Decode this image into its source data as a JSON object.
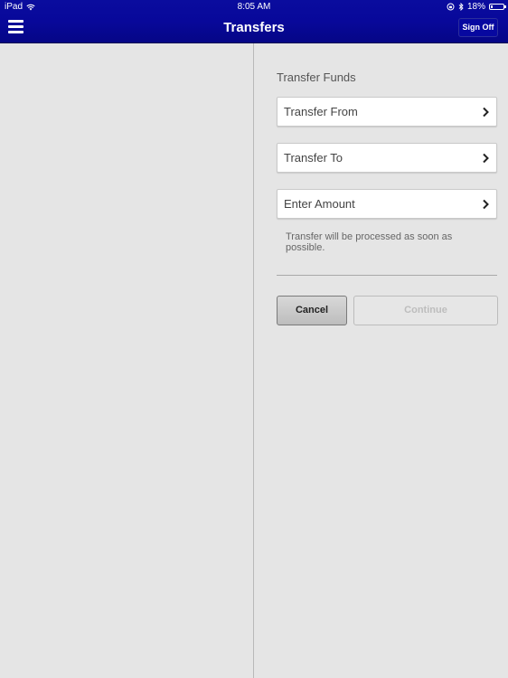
{
  "status_bar": {
    "device": "iPad",
    "time": "8:05 AM",
    "battery_percent": "18%",
    "battery_level": 0.18,
    "icons": [
      "wifi-icon",
      "orientation-lock-icon",
      "bluetooth-icon",
      "battery-icon"
    ]
  },
  "header": {
    "title": "Transfers",
    "sign_off_label": "Sign Off",
    "menu_icon": "hamburger-menu-icon",
    "bar_color": "#08089a"
  },
  "transfer_form": {
    "section_title": "Transfer Funds",
    "fields": [
      {
        "label": "Transfer From",
        "icon": "chevron-right-icon"
      },
      {
        "label": "Transfer To",
        "icon": "chevron-right-icon"
      },
      {
        "label": "Enter Amount",
        "icon": "chevron-right-icon"
      }
    ],
    "note": "Transfer will be processed as soon as possible.",
    "cancel_label": "Cancel",
    "continue_label": "Continue",
    "continue_enabled": false
  }
}
